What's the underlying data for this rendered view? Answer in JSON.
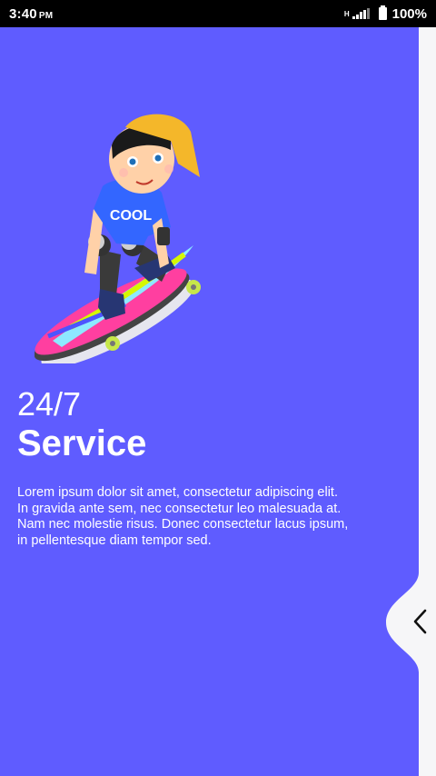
{
  "status_bar": {
    "time": "3:40",
    "ampm": "PM",
    "network_type": "H",
    "battery_percent": "100%"
  },
  "slide": {
    "title_small": "24/7",
    "title_big": "Service",
    "description": "Lorem ipsum dolor sit amet, consectetur adipiscing elit. In gravida ante sem, nec consectetur leo malesuada at. Nam nec molestie risus. Donec consectetur lacus ipsum, in pellentesque diam tempor sed.",
    "illustration_shirt_text": "COOL"
  },
  "colors": {
    "panel_background": "#5f5cff",
    "page_background": "#f6f6f8",
    "status_bar": "#000000",
    "text": "#ffffff"
  },
  "icons": {
    "back_tab": "chevron-left-icon"
  }
}
